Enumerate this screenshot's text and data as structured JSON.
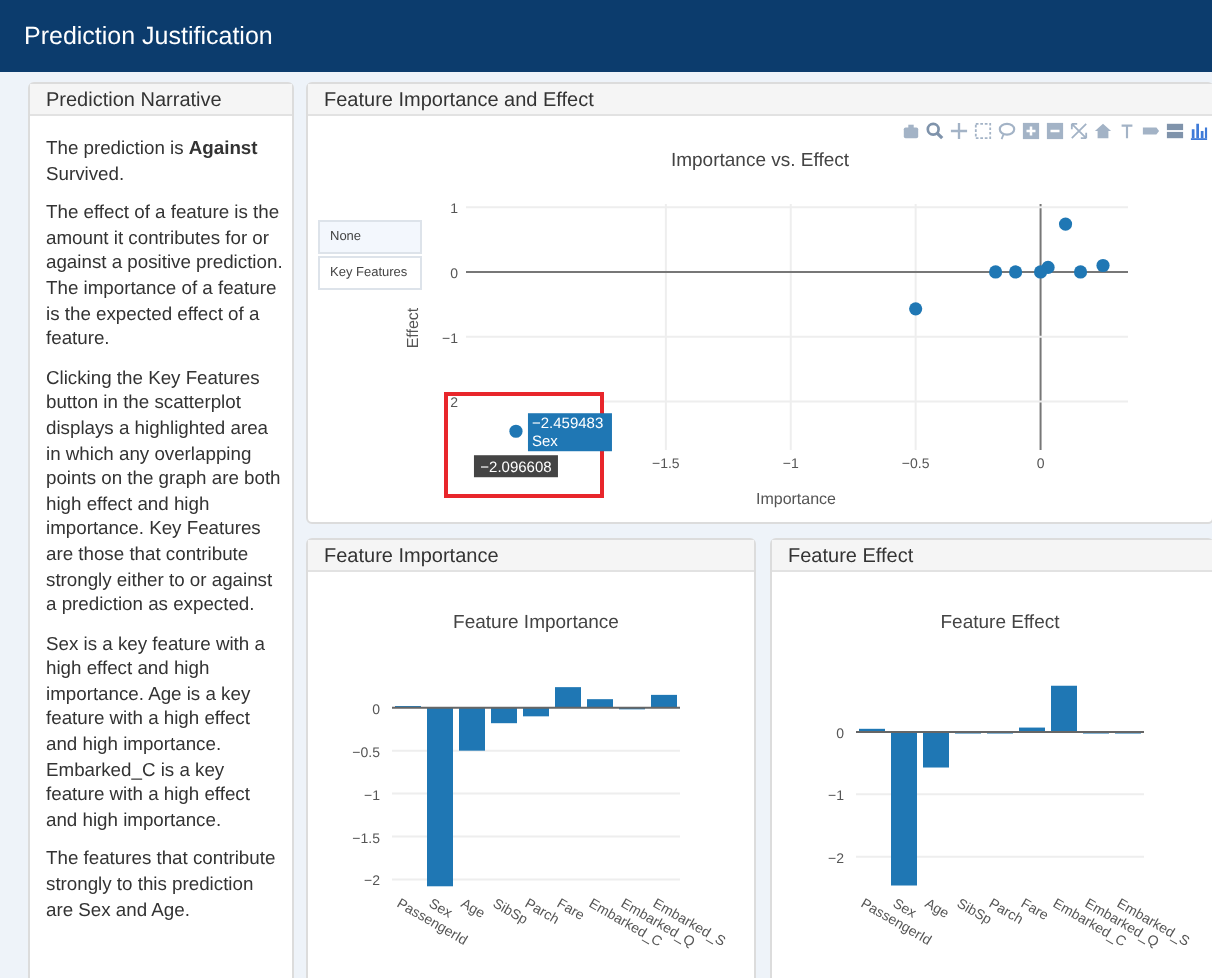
{
  "header": {
    "title": "Prediction Justification"
  },
  "narrative": {
    "title": "Prediction Narrative",
    "paragraphs": [
      "The prediction is **Against** Survived.",
      "The effect of a feature is the amount it contributes for or against a positive prediction. The importance of a feature is the expected effect of a feature.",
      "Clicking the Key Features button in the scatterplot displays a highlighted area in which any overlapping points on the graph are both high effect and high importance. Key Features are those that contribute strongly either to or against a prediction as expected.",
      "Sex is a key feature with a high effect and high importance. Age is a key feature with a high effect and high importance. Embarked_C is a key feature with a high effect and high importance.",
      "The features that contribute strongly to this prediction are Sex and Age."
    ]
  },
  "scatter_panel": {
    "title": "Feature Importance and Effect",
    "buttons": [
      {
        "label": "None",
        "selected": true
      },
      {
        "label": "Key Features",
        "selected": false
      }
    ],
    "hover": {
      "effect": "−2.459483",
      "name": "Sex",
      "importance": "−2.096608"
    },
    "chart_data": {
      "type": "scatter",
      "title": "Importance vs. Effect",
      "xlabel": "Importance",
      "ylabel": "Effect",
      "grid": true,
      "series": [
        {
          "color": "#1f77b4",
          "x": [
            0.03,
            -2.1,
            -0.5,
            -0.18,
            -0.1,
            0.25,
            0.1,
            0,
            0.16
          ],
          "values": [
            0.07,
            -2.46,
            -0.57,
            0,
            0,
            0.1,
            0.74,
            0,
            0
          ]
        }
      ],
      "xlim": [
        -2.3,
        0.35
      ],
      "ylim": [
        -2.75,
        1.05
      ],
      "xticks": [
        {
          "value": -1.5,
          "label": "−1.5"
        },
        {
          "value": -1,
          "label": "−1"
        },
        {
          "value": -0.5,
          "label": "−0.5"
        },
        {
          "value": 0,
          "label": "0"
        }
      ],
      "yticks": [
        {
          "value": 1,
          "label": "1"
        },
        {
          "value": 0,
          "label": "0"
        },
        {
          "value": -1,
          "label": "−1"
        },
        {
          "value": -2,
          "label": "2"
        }
      ]
    }
  },
  "bar_panels": [
    {
      "title": "Feature Importance",
      "chart_data": {
        "type": "bar",
        "title": "Feature Importance",
        "categories": [
          "PassengerId",
          "Sex",
          "Age",
          "SibSp",
          "Parch",
          "Fare",
          "Embarked_C",
          "Embarked_Q",
          "Embarked_S"
        ],
        "grid": true,
        "series": [
          {
            "color": "#1f77b4",
            "values": [
              0.02,
              -2.08,
              -0.5,
              -0.18,
              -0.1,
              0.24,
              0.1,
              0,
              0.15
            ]
          }
        ],
        "ylim": [
          -2.1,
          0.3
        ],
        "yticks": [
          {
            "value": 0,
            "label": "0"
          },
          {
            "value": -0.5,
            "label": "−0.5"
          },
          {
            "value": -1,
            "label": "−1"
          },
          {
            "value": -1.5,
            "label": "−1.5"
          },
          {
            "value": -2,
            "label": "−2"
          }
        ]
      }
    },
    {
      "title": "Feature Effect",
      "chart_data": {
        "type": "bar",
        "title": "Feature Effect",
        "categories": [
          "PassengerId",
          "Sex",
          "Age",
          "SibSp",
          "Parch",
          "Fare",
          "Embarked_C",
          "Embarked_Q",
          "Embarked_S"
        ],
        "grid": true,
        "series": [
          {
            "color": "#1f77b4",
            "values": [
              0.05,
              -2.46,
              -0.57,
              0,
              0,
              0.07,
              0.74,
              0,
              0
            ]
          }
        ],
        "ylim": [
          -2.5,
          0.8
        ],
        "yticks": [
          {
            "value": 0,
            "label": "0"
          },
          {
            "value": -1,
            "label": "−1"
          },
          {
            "value": -2,
            "label": "−2"
          }
        ]
      }
    }
  ]
}
